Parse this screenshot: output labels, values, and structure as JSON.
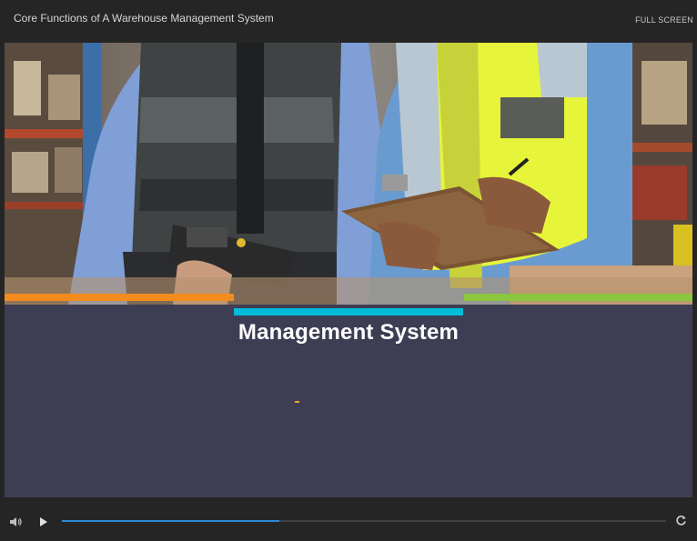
{
  "header": {
    "title": "Core Functions of A Warehouse Management System",
    "fullscreen_label": "FULL SCREEN"
  },
  "slide": {
    "title": "Management System",
    "accent_colors": {
      "orange": "#f28c1c",
      "cyan": "#00bcd9",
      "green": "#8cc63f"
    }
  },
  "player": {
    "progress": 0.36,
    "icons": [
      "volume-icon",
      "play-icon",
      "replay-icon"
    ]
  }
}
